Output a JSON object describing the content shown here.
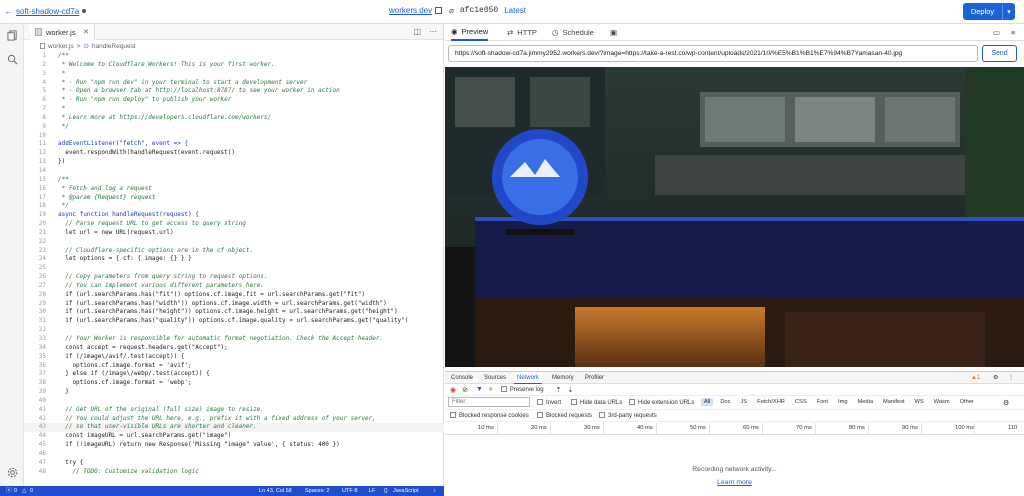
{
  "topbar": {
    "worker_name": "soft-shadow-cd7a",
    "dev_link": "workers.dev",
    "commit": "afc1e050",
    "latest": "Latest",
    "deploy_label": "Deploy"
  },
  "editor": {
    "tab_label": "worker.js",
    "breadcrumb_file": "worker.js",
    "breadcrumb_sep": ">",
    "breadcrumb_fn": "handleRequest",
    "lines": [
      {
        "n": "1",
        "t": "/**",
        "c": "comment"
      },
      {
        "n": "2",
        "t": " * Welcome to Cloudflare Workers! This is your first worker.",
        "c": "comment"
      },
      {
        "n": "3",
        "t": " *",
        "c": "comment"
      },
      {
        "n": "4",
        "t": " * - Run \"npm run dev\" in your terminal to start a development server",
        "c": "comment"
      },
      {
        "n": "5",
        "t": " * - Open a browser tab at http://localhost:8787/ to see your worker in action",
        "c": "comment"
      },
      {
        "n": "6",
        "t": " * - Run \"npm run deploy\" to publish your worker",
        "c": "comment"
      },
      {
        "n": "7",
        "t": " *",
        "c": "comment"
      },
      {
        "n": "8",
        "t": " * Learn more at https://developers.cloudflare.com/workers/",
        "c": "comment"
      },
      {
        "n": "9",
        "t": " */",
        "c": "comment"
      },
      {
        "n": "10",
        "t": "",
        "c": ""
      },
      {
        "n": "11",
        "t": "addEventListener(\"fetch\", event => {",
        "c": "kw"
      },
      {
        "n": "12",
        "t": "  event.respondWith(handleRequest(event.request))",
        "c": ""
      },
      {
        "n": "13",
        "t": "})",
        "c": ""
      },
      {
        "n": "14",
        "t": "",
        "c": ""
      },
      {
        "n": "15",
        "t": "/**",
        "c": "comment"
      },
      {
        "n": "16",
        "t": " * Fetch and log a request",
        "c": "comment"
      },
      {
        "n": "17",
        "t": " * @param {Request} request",
        "c": "comment"
      },
      {
        "n": "18",
        "t": " */",
        "c": "comment"
      },
      {
        "n": "19",
        "t": "async function handleRequest(request) {",
        "c": "kw"
      },
      {
        "n": "20",
        "t": "  // Parse request URL to get access to query string",
        "c": "comment"
      },
      {
        "n": "21",
        "t": "  let url = new URL(request.url)",
        "c": ""
      },
      {
        "n": "22",
        "t": "",
        "c": ""
      },
      {
        "n": "23",
        "t": "  // Cloudflare-specific options are in the cf object.",
        "c": "comment"
      },
      {
        "n": "24",
        "t": "  let options = { cf: { image: {} } }",
        "c": ""
      },
      {
        "n": "25",
        "t": "",
        "c": ""
      },
      {
        "n": "26",
        "t": "  // Copy parameters from query string to request options.",
        "c": "comment"
      },
      {
        "n": "27",
        "t": "  // You can implement various different parameters here.",
        "c": "comment"
      },
      {
        "n": "28",
        "t": "  if (url.searchParams.has(\"fit\")) options.cf.image.fit = url.searchParams.get(\"fit\")",
        "c": ""
      },
      {
        "n": "29",
        "t": "  if (url.searchParams.has(\"width\")) options.cf.image.width = url.searchParams.get(\"width\")",
        "c": ""
      },
      {
        "n": "30",
        "t": "  if (url.searchParams.has(\"height\")) options.cf.image.height = url.searchParams.get(\"height\")",
        "c": ""
      },
      {
        "n": "31",
        "t": "  if (url.searchParams.has(\"quality\")) options.cf.image.quality = url.searchParams.get(\"quality\")",
        "c": ""
      },
      {
        "n": "32",
        "t": "",
        "c": ""
      },
      {
        "n": "33",
        "t": "  // Your Worker is responsible for automatic format negotiation. Check the Accept header.",
        "c": "comment"
      },
      {
        "n": "34",
        "t": "  const accept = request.headers.get(\"Accept\");",
        "c": ""
      },
      {
        "n": "35",
        "t": "  if (/image\\/avif/.test(accept)) {",
        "c": ""
      },
      {
        "n": "36",
        "t": "    options.cf.image.format = 'avif';",
        "c": ""
      },
      {
        "n": "37",
        "t": "  } else if (/image\\/webp/.test(accept)) {",
        "c": ""
      },
      {
        "n": "38",
        "t": "    options.cf.image.format = 'webp';",
        "c": ""
      },
      {
        "n": "39",
        "t": "  }",
        "c": ""
      },
      {
        "n": "40",
        "t": "",
        "c": ""
      },
      {
        "n": "41",
        "t": "  // Get URL of the original (full size) image to resize.",
        "c": "comment"
      },
      {
        "n": "42",
        "t": "  // You could adjust the URL here, e.g., prefix it with a fixed address of your server,",
        "c": "comment"
      },
      {
        "n": "43",
        "t": "  // so that user-visible URLs are shorter and cleaner.",
        "c": "comment"
      },
      {
        "n": "44",
        "t": "  const imageURL = url.searchParams.get(\"image\")",
        "c": ""
      },
      {
        "n": "45",
        "t": "  if (!imageURL) return new Response('Missing \"image\" value', { status: 400 })",
        "c": ""
      },
      {
        "n": "46",
        "t": "",
        "c": ""
      },
      {
        "n": "47",
        "t": "  try {",
        "c": ""
      },
      {
        "n": "48",
        "t": "    // TODO: Customize validation logic",
        "c": "comment"
      }
    ]
  },
  "statusbar": {
    "errors": "0",
    "warnings": "0",
    "position": "Ln 43, Col 58",
    "spaces": "Spaces: 2",
    "encoding": "UTF-8",
    "eol": "LF",
    "language": "JavaScript"
  },
  "right": {
    "tab_preview": "Preview",
    "tab_http": "HTTP",
    "tab_schedule": "Schedule",
    "url": "https://soft-shadow-cd7a.jimmy2952.workers.dev/?image=https://take-a-rest.co/wp-content/uploads/2021/10/%E5%B1%B1%E7%94%B7Yamasan-40.jpg",
    "send_label": "Send"
  },
  "devtools": {
    "tabs": [
      "Console",
      "Sources",
      "Network",
      "Memory",
      "Profiler"
    ],
    "active_tab": "Network",
    "preserve_log": "Preserve log",
    "filter_placeholder": "Filter",
    "invert": "Invert",
    "hide_data_urls": "Hide data URLs",
    "hide_ext_urls": "Hide extension URLs",
    "types": [
      "All",
      "Doc",
      "JS",
      "Fetch/XHR",
      "CSS",
      "Font",
      "Img",
      "Media",
      "Manifest",
      "WS",
      "Wasm",
      "Other"
    ],
    "blocked_cookies": "Blocked response cookies",
    "blocked_requests": "Blocked requests",
    "third_party": "3rd-party requests",
    "ticks": [
      "10 ms",
      "20 ms",
      "30 ms",
      "40 ms",
      "50 ms",
      "60 ms",
      "70 ms",
      "80 ms",
      "90 ms",
      "100 ms",
      "110"
    ],
    "recording": "Recording network activity...",
    "learn_more": "Learn more"
  }
}
